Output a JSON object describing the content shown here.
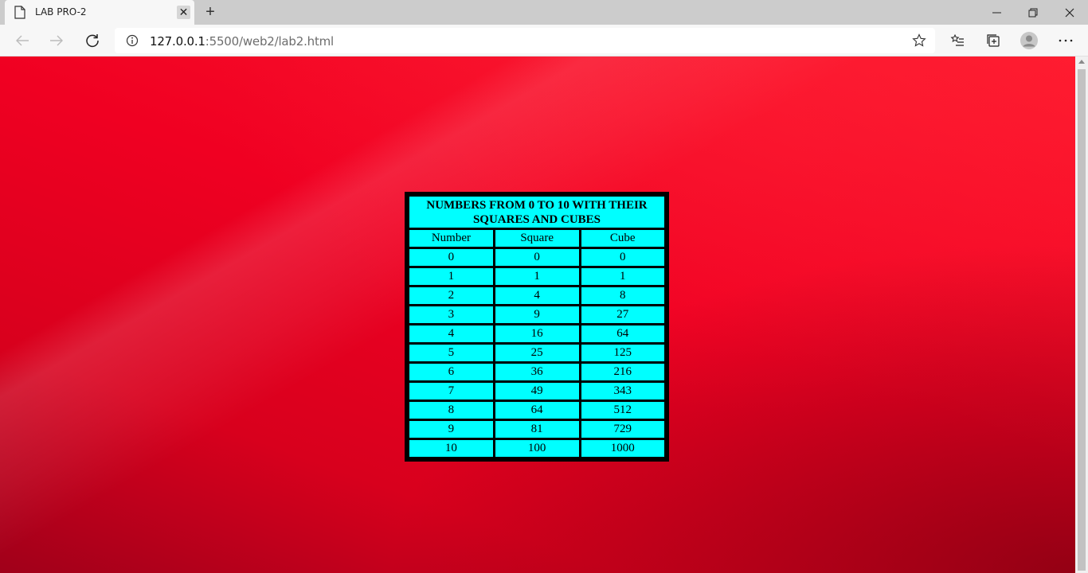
{
  "browser": {
    "tab_title": "LAB PRO-2",
    "tab_close_glyph": "✕",
    "new_tab_glyph": "+",
    "url_host": "127.0.0.1",
    "url_path": ":5500/web2/lab2.html"
  },
  "page": {
    "background_color": "#f00022",
    "table": {
      "caption": "NUMBERS FROM 0 TO 10 WITH THEIR SQUARES AND CUBES",
      "headers": [
        "Number",
        "Square",
        "Cube"
      ],
      "rows": [
        [
          "0",
          "0",
          "0"
        ],
        [
          "1",
          "1",
          "1"
        ],
        [
          "2",
          "4",
          "8"
        ],
        [
          "3",
          "9",
          "27"
        ],
        [
          "4",
          "16",
          "64"
        ],
        [
          "5",
          "25",
          "125"
        ],
        [
          "6",
          "36",
          "216"
        ],
        [
          "7",
          "49",
          "343"
        ],
        [
          "8",
          "64",
          "512"
        ],
        [
          "9",
          "81",
          "729"
        ],
        [
          "10",
          "100",
          "1000"
        ]
      ],
      "cell_color": "#00ffff",
      "border_color": "#000000"
    }
  }
}
